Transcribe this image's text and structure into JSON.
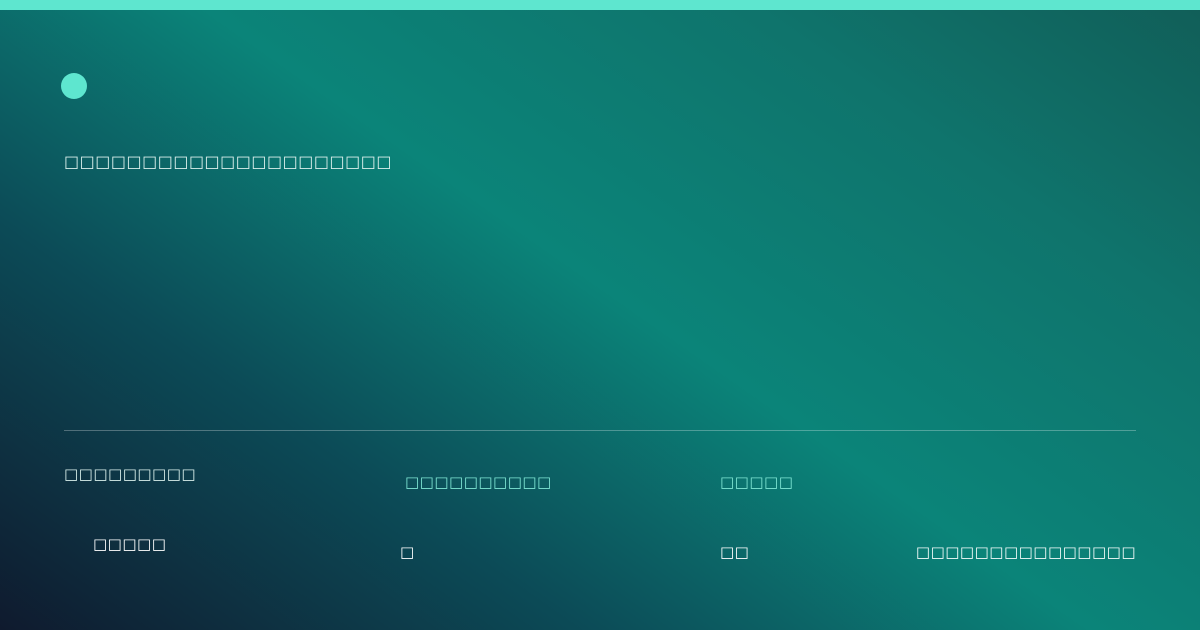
{
  "card": {
    "accent_color": "#5ee6cf",
    "subtitle": "□□□□□□□□□□□□□□□□□□□□□",
    "stats": [
      {
        "label": "□□□□□□□□□",
        "value": "□□□□□"
      },
      {
        "label": "□□□□□□□□□□",
        "value": "□"
      },
      {
        "label": "□□□□□",
        "value": "□□"
      }
    ],
    "footer_note": "□□□□□□□□□□□□□□□"
  }
}
